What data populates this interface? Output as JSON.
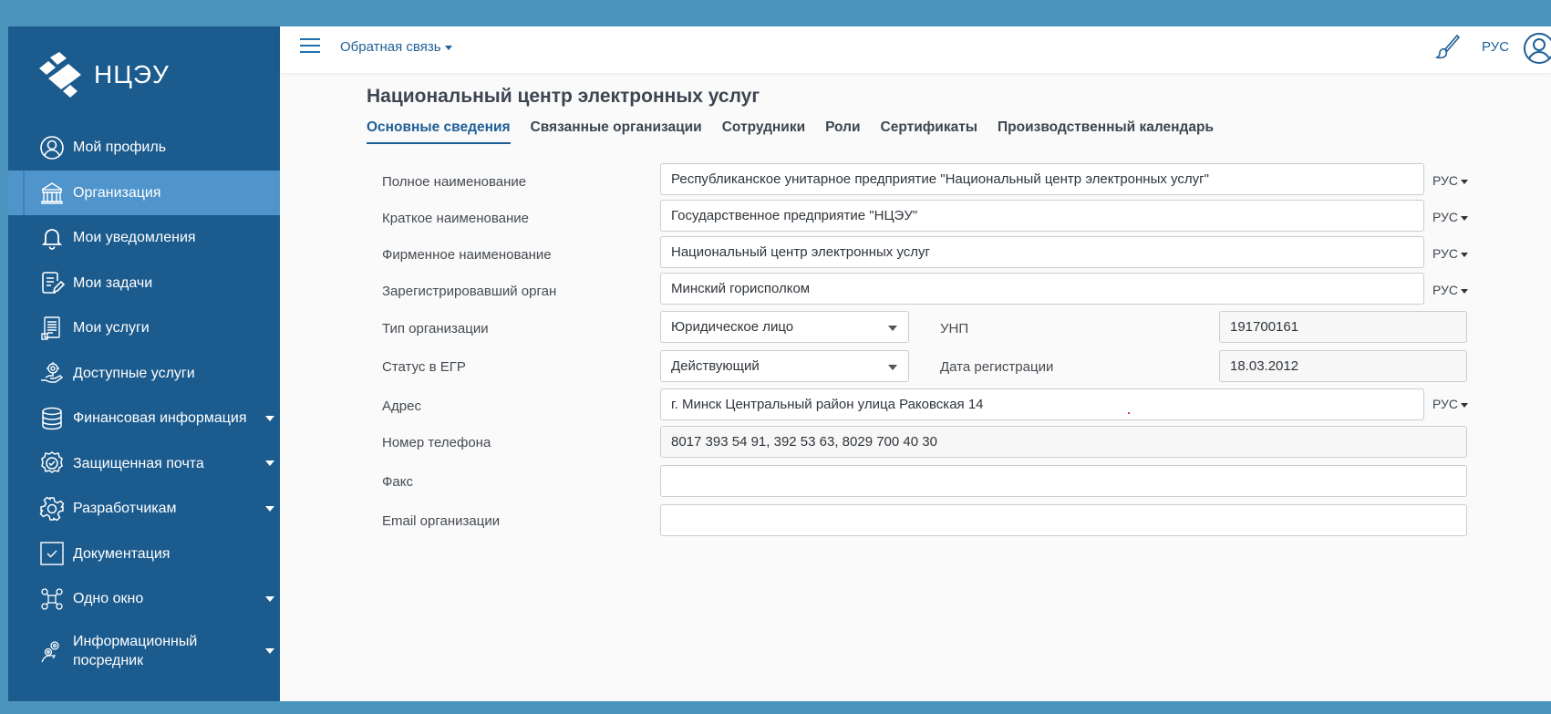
{
  "app": {
    "logo_text": "НЦЭУ"
  },
  "sidebar": {
    "items": [
      {
        "label": "Мой профиль",
        "icon": "user-circle-icon",
        "active": false,
        "has_submenu": false
      },
      {
        "label": "Организация",
        "icon": "building-icon",
        "active": true,
        "has_submenu": false
      },
      {
        "label": "Мои уведомления",
        "icon": "bell-icon",
        "active": false,
        "has_submenu": false
      },
      {
        "label": "Мои задачи",
        "icon": "task-edit-icon",
        "active": false,
        "has_submenu": false
      },
      {
        "label": "Мои услуги",
        "icon": "document-list-icon",
        "active": false,
        "has_submenu": false
      },
      {
        "label": "Доступные услуги",
        "icon": "hand-gear-icon",
        "active": false,
        "has_submenu": false
      },
      {
        "label": "Финансовая информация",
        "icon": "database-icon",
        "active": false,
        "has_submenu": true
      },
      {
        "label": "Защищенная почта",
        "icon": "shield-check-icon",
        "active": false,
        "has_submenu": true
      },
      {
        "label": "Разработчикам",
        "icon": "gear-icon",
        "active": false,
        "has_submenu": true
      },
      {
        "label": "Документация",
        "icon": "checkbox-icon",
        "active": false,
        "has_submenu": false
      },
      {
        "label": "Одно окно",
        "icon": "network-icon",
        "active": false,
        "has_submenu": true
      },
      {
        "label": "Информационный посредник",
        "icon": "gears-hand-icon",
        "active": false,
        "has_submenu": true
      }
    ]
  },
  "topbar": {
    "feedback_label": "Обратная связь",
    "language": "РУС",
    "icons": [
      "menu-icon",
      "brush-icon",
      "user-circle-icon"
    ]
  },
  "main": {
    "title": "Национальный центр электронных услуг",
    "tabs": [
      {
        "label": "Основные сведения",
        "active": true
      },
      {
        "label": "Связанные организации",
        "active": false
      },
      {
        "label": "Сотрудники",
        "active": false
      },
      {
        "label": "Роли",
        "active": false
      },
      {
        "label": "Сертификаты",
        "active": false
      },
      {
        "label": "Производственный календарь",
        "active": false
      }
    ],
    "form": {
      "full_name": {
        "label": "Полное наименование",
        "value": "Республиканское унитарное предприятие \"Национальный центр электронных услуг\"",
        "lang": "РУС"
      },
      "short_name": {
        "label": "Краткое наименование",
        "value": "Государственное предприятие \"НЦЭУ\"",
        "lang": "РУС"
      },
      "brand_name": {
        "label": "Фирменное наименование",
        "value": "Национальный центр электронных услуг",
        "lang": "РУС"
      },
      "reg_authority": {
        "label": "Зарегистрировавший орган",
        "value": "Минский горисполком",
        "lang": "РУС"
      },
      "org_type": {
        "label": "Тип организации",
        "value": "Юридическое лицо"
      },
      "unp": {
        "label": "УНП",
        "value": "191700161"
      },
      "egr_status": {
        "label": "Статус в ЕГР",
        "value": "Действующий"
      },
      "reg_date": {
        "label": "Дата регистрации",
        "value": "18.03.2012"
      },
      "address": {
        "label": "Адрес",
        "value": "г. Минск Центральный район улица Раковская 14",
        "lang": "РУС"
      },
      "phone": {
        "label": "Номер телефона",
        "value": "8017 393 54 91, 392 53 63, 8029 700 40 30"
      },
      "fax": {
        "label": "Факс",
        "value": ""
      },
      "email": {
        "label": "Email организации",
        "value": ""
      }
    }
  },
  "colors": {
    "sidebar_bg": "#1b5b8e",
    "sidebar_active": "#4f94cb",
    "outer_bg": "#4b94bd",
    "accent": "#1f5f97"
  }
}
